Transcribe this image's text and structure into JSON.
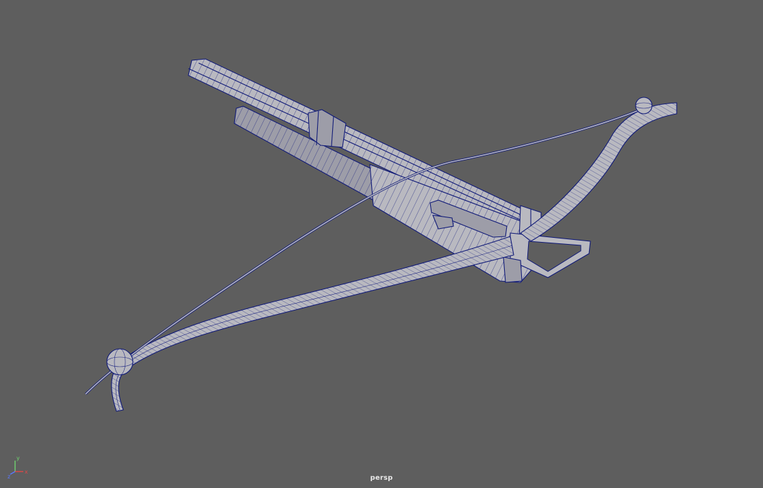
{
  "viewport": {
    "camera_label": "persp",
    "background_color": "#5e5e5e",
    "wireframe_color": "#101a78",
    "surface_color": "#b9b9c0",
    "model_name": "crossbow"
  },
  "axis_gizmo": {
    "y_label": "y",
    "x_label": "x",
    "z_label": "z",
    "y_color": "#6fd36f",
    "x_color": "#e04848",
    "z_color": "#5a78ff"
  }
}
